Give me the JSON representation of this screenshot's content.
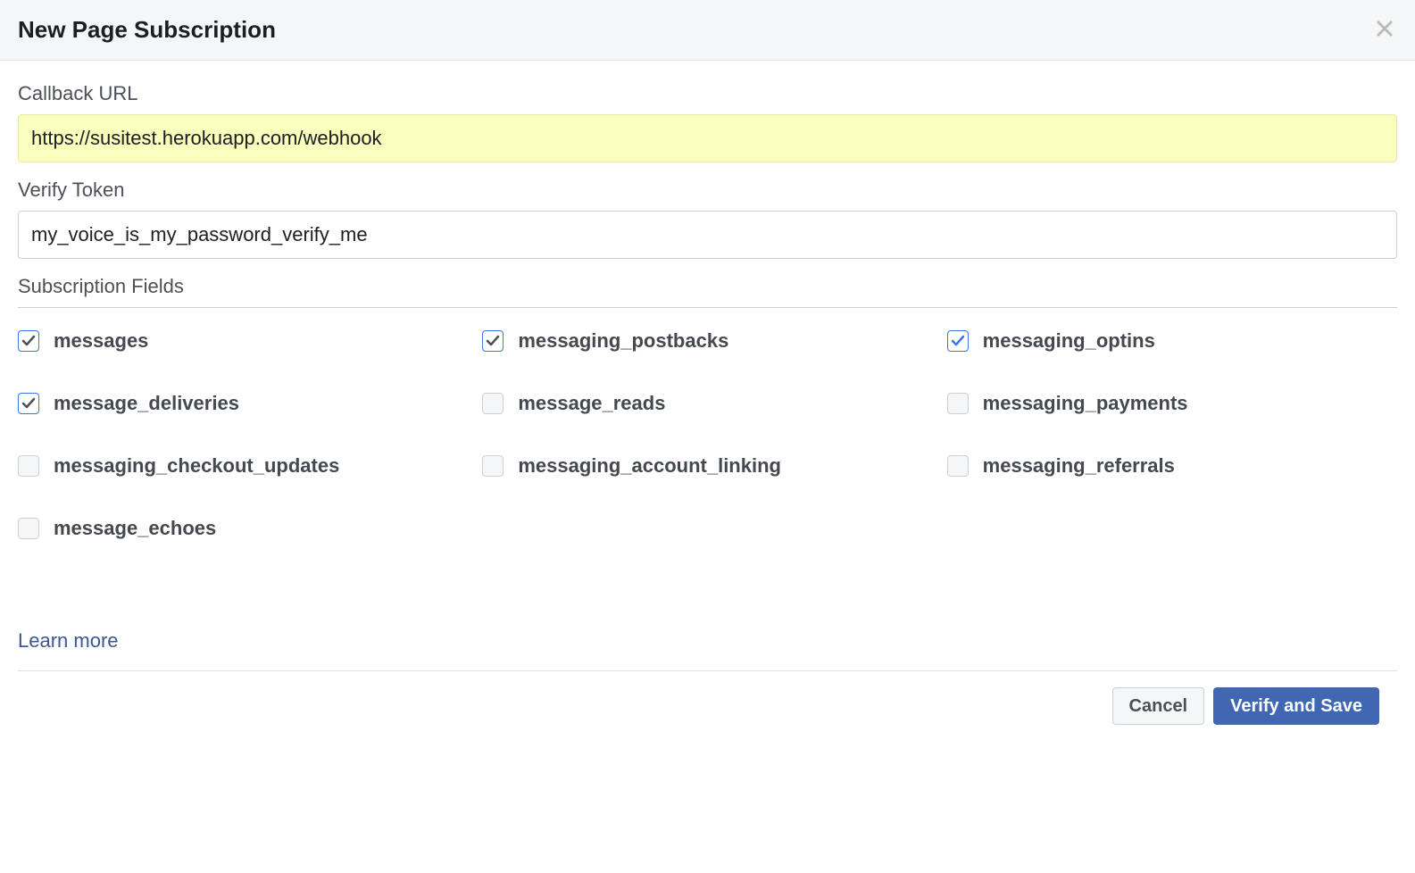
{
  "modal": {
    "title": "New Page Subscription",
    "callback_url_label": "Callback URL",
    "callback_url_value": "https://susitest.herokuapp.com/webhook",
    "verify_token_label": "Verify Token",
    "verify_token_value": "my_voice_is_my_password_verify_me",
    "subscription_fields_label": "Subscription Fields",
    "fields": [
      {
        "name": "messages",
        "checked": true
      },
      {
        "name": "messaging_postbacks",
        "checked": true
      },
      {
        "name": "messaging_optins",
        "checked": true
      },
      {
        "name": "message_deliveries",
        "checked": true
      },
      {
        "name": "message_reads",
        "checked": false
      },
      {
        "name": "messaging_payments",
        "checked": false
      },
      {
        "name": "messaging_checkout_updates",
        "checked": false
      },
      {
        "name": "messaging_account_linking",
        "checked": false
      },
      {
        "name": "messaging_referrals",
        "checked": false
      },
      {
        "name": "message_echoes",
        "checked": false
      }
    ],
    "learn_more_label": "Learn more",
    "cancel_label": "Cancel",
    "verify_save_label": "Verify and Save"
  }
}
